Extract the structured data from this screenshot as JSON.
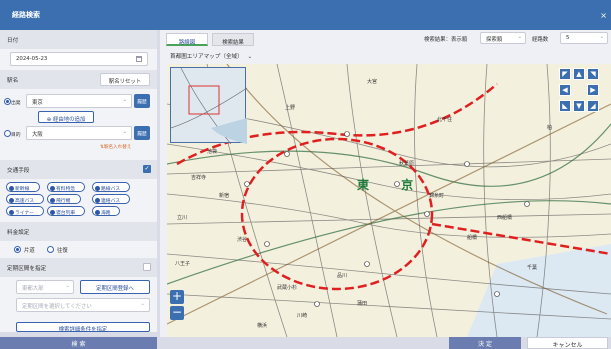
{
  "window": {
    "title": "経路検索",
    "close": "×"
  },
  "date": {
    "label": "日付",
    "value": "2024-05-23"
  },
  "station": {
    "label": "駅名",
    "reset": "駅名リセット",
    "from_label": "出発",
    "from_value": "東京",
    "add_via": "経由地の追加",
    "to_label": "目的",
    "to_value": "大阪",
    "swap": "⇅駅名入れ替え",
    "history": "履歴"
  },
  "transport": {
    "label": "交通手段",
    "chips": [
      "新幹線",
      "有料特急",
      "路線バス",
      "高速バス",
      "飛行機",
      "連絡バス",
      "ライナー",
      "寝台列車",
      "海路"
    ]
  },
  "fare": {
    "label": "料金設定",
    "options": [
      "片道",
      "往復"
    ],
    "selected": 0
  },
  "commuter": {
    "label": "定期区間を指定",
    "select_placeholder": "東都大部",
    "register": "定期区間登録へ",
    "select2_placeholder": "定期区間を選択してください",
    "detail": "検索詳細条件を指定"
  },
  "search_button": "検 索",
  "results": {
    "tabs": [
      "路線図",
      "検索結果"
    ],
    "sort_label": "検索結果：表示順",
    "sort_value": "探索順",
    "count_label": "経路数",
    "count_value": "5",
    "area_label": "首都圏エリアマップ（全域）"
  },
  "footer": {
    "ok": "決 定",
    "cancel": "キャンセル"
  },
  "map": {
    "center_label": "東 京",
    "stations": [
      "上野",
      "池袋",
      "新宿",
      "渋谷",
      "品川",
      "川崎",
      "横浜",
      "大宮",
      "千葉",
      "船橋",
      "立川",
      "八王子",
      "武蔵小杉",
      "錦糸町",
      "秋葉原",
      "北千住",
      "西船橋",
      "吉祥寺",
      "蒲田",
      "柏"
    ]
  },
  "colors": {
    "primary": "#3c6fb0",
    "accent": "#2f57a8",
    "route": "#e02020"
  }
}
